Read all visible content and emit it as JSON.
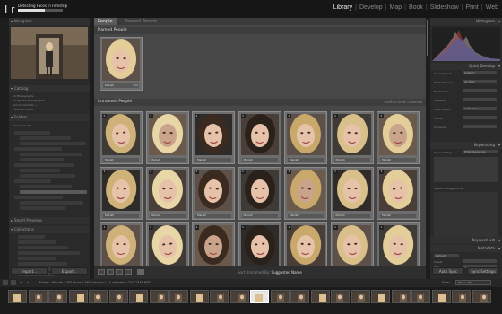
{
  "id_plate": {
    "logo": "Lr",
    "task": "Detecting Faces in Filmstrip",
    "task_progress": 0.6
  },
  "modules": [
    "Library",
    "Develop",
    "Map",
    "Book",
    "Slideshow",
    "Print",
    "Web"
  ],
  "active_module": "Library",
  "left_panel": {
    "navigator_title": "Navigator",
    "catalog_title": "Catalog",
    "catalog_items": [
      {
        "label": "All Photographs"
      },
      {
        "label": "All Synced Photographs"
      },
      {
        "label": "Quick Collection +"
      },
      {
        "label": "Previous Import"
      }
    ],
    "folders_title": "Folders",
    "folders_volume": "Macintosh HD",
    "collections_title": "Collections",
    "smart_previews_title": "Smart Previews",
    "import_label": "Import...",
    "export_label": "Export..."
  },
  "tabs": {
    "people": "People",
    "other": "Named Person"
  },
  "named_section": {
    "title": "Named People"
  },
  "named_card": {
    "name": "Mariah",
    "count": "150"
  },
  "unnamed_section": {
    "title": "Unnamed People",
    "right": "Confirm for all unnamed"
  },
  "unnamed_cards": [
    {
      "n": "5",
      "name": "Mariah"
    },
    {
      "n": "3",
      "name": "Mariah"
    },
    {
      "n": "4",
      "name": "Mariah"
    },
    {
      "n": "3",
      "name": "Mariah"
    },
    {
      "n": "2",
      "name": "Mariah"
    },
    {
      "n": "2",
      "name": "Mariah"
    },
    {
      "n": "5",
      "name": "Mariah"
    },
    {
      "n": "1",
      "name": "Mariah"
    },
    {
      "n": "1",
      "name": "Mariah"
    },
    {
      "n": "1",
      "name": "Mariah"
    },
    {
      "n": "1",
      "name": "Mariah"
    },
    {
      "n": "1",
      "name": "Mariah"
    },
    {
      "n": "1",
      "name": "Mariah"
    },
    {
      "n": "1",
      "name": "Mariah"
    },
    {
      "n": "1",
      "name": ""
    },
    {
      "n": "1",
      "name": ""
    },
    {
      "n": "1",
      "name": ""
    },
    {
      "n": "1",
      "name": ""
    },
    {
      "n": "1",
      "name": ""
    },
    {
      "n": "1",
      "name": ""
    },
    {
      "n": "1",
      "name": ""
    }
  ],
  "bottom_bar": {
    "sort_label": "Sort Unnamed By:",
    "sort_value": "Suggested Name"
  },
  "right_panel": {
    "histogram_title": "Histogram",
    "quick_develop_title": "Quick Develop",
    "quick_develop_rows": [
      {
        "label": "Saved Preset",
        "value": "Custom"
      },
      {
        "label": "White Balance",
        "value": "As Shot"
      },
      {
        "label": "Treatment",
        "value": ""
      },
      {
        "label": "Exposure",
        "value": ""
      },
      {
        "label": "Tone Control",
        "value": "Auto Tone"
      },
      {
        "label": "Clarity",
        "value": ""
      },
      {
        "label": "Vibrance",
        "value": ""
      }
    ],
    "keywording_title": "Keywording",
    "keyword_tags_label": "Keyword Tags",
    "keyword_tags_value": "Enter Keywords",
    "keyword_suggestions_title": "Keyword Suggestions",
    "keyword_list_title": "Keyword List",
    "metadata_title": "Metadata",
    "metadata_preset": "Default",
    "metadata_rows": [
      {
        "label": "Preset"
      },
      {
        "label": "Title"
      }
    ],
    "sync_label": "Auto Sync",
    "sync_settings_label": "Sync Settings"
  },
  "filmstrip": {
    "path": "Folder : Mariah",
    "count": "267 faces / 1605 photos / 14 selected / 220 2348.NEF",
    "filter_label": "Filter :",
    "filter_value": "Filters Off"
  },
  "colors": {
    "accent": "#e0e0e0",
    "panel": "#2a2a2a",
    "grid": "#474747"
  }
}
